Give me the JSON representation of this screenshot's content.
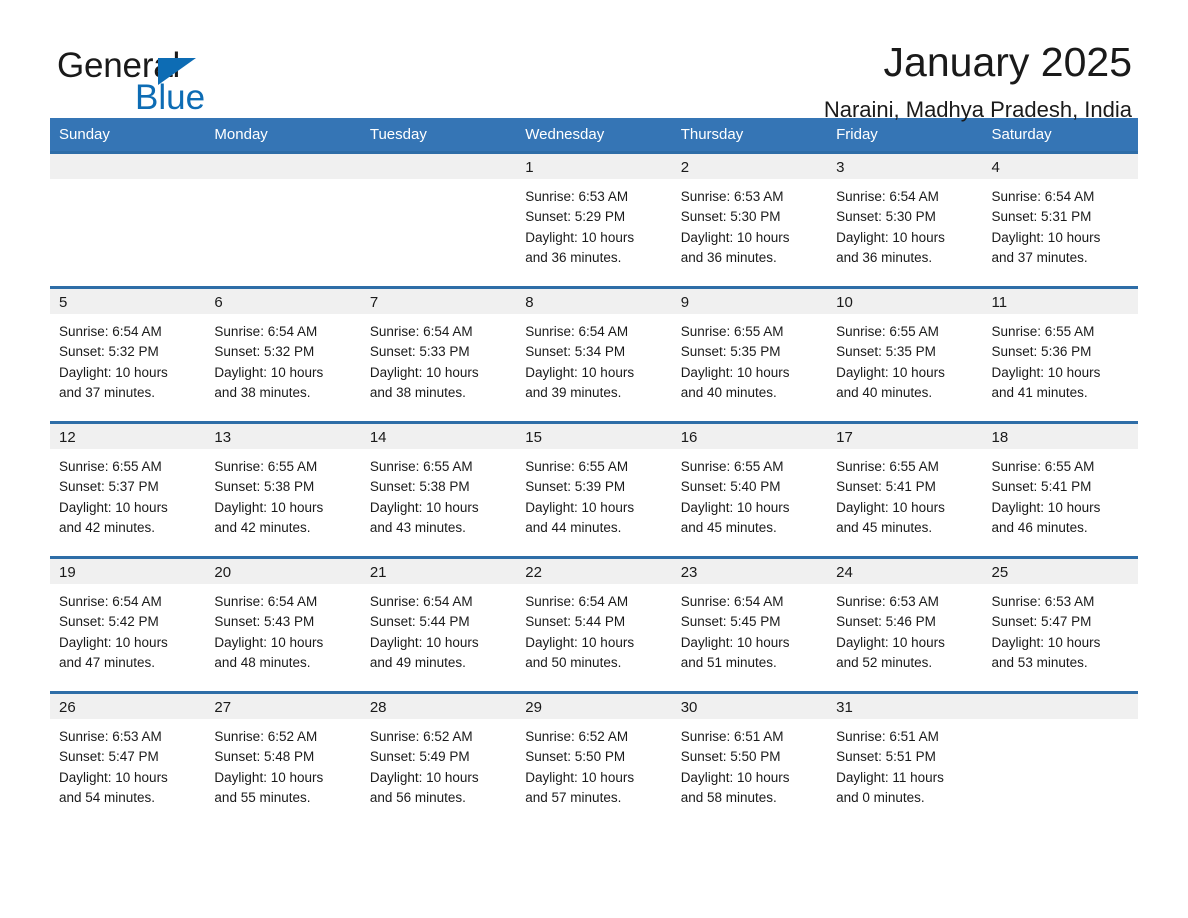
{
  "brand": {
    "word1": "General",
    "word2": "Blue",
    "triangle_color": "#0d6cb4"
  },
  "header": {
    "month_title": "January 2025",
    "location": "Naraini, Madhya Pradesh, India",
    "header_bg": "#3575b5",
    "row_border": "#2e6da7",
    "daynum_bg": "#f0f0f0"
  },
  "weekdays": [
    "Sunday",
    "Monday",
    "Tuesday",
    "Wednesday",
    "Thursday",
    "Friday",
    "Saturday"
  ],
  "labels": {
    "sunrise_prefix": "Sunrise:",
    "sunset_prefix": "Sunset:",
    "daylight_prefix": "Daylight:"
  },
  "weeks": [
    [
      {
        "day": "",
        "empty": true
      },
      {
        "day": "",
        "empty": true
      },
      {
        "day": "",
        "empty": true
      },
      {
        "day": "1",
        "line1": "Sunrise: 6:53 AM",
        "line2": "Sunset: 5:29 PM",
        "line3": "Daylight: 10 hours",
        "line4": "and 36 minutes."
      },
      {
        "day": "2",
        "line1": "Sunrise: 6:53 AM",
        "line2": "Sunset: 5:30 PM",
        "line3": "Daylight: 10 hours",
        "line4": "and 36 minutes."
      },
      {
        "day": "3",
        "line1": "Sunrise: 6:54 AM",
        "line2": "Sunset: 5:30 PM",
        "line3": "Daylight: 10 hours",
        "line4": "and 36 minutes."
      },
      {
        "day": "4",
        "line1": "Sunrise: 6:54 AM",
        "line2": "Sunset: 5:31 PM",
        "line3": "Daylight: 10 hours",
        "line4": "and 37 minutes."
      }
    ],
    [
      {
        "day": "5",
        "line1": "Sunrise: 6:54 AM",
        "line2": "Sunset: 5:32 PM",
        "line3": "Daylight: 10 hours",
        "line4": "and 37 minutes."
      },
      {
        "day": "6",
        "line1": "Sunrise: 6:54 AM",
        "line2": "Sunset: 5:32 PM",
        "line3": "Daylight: 10 hours",
        "line4": "and 38 minutes."
      },
      {
        "day": "7",
        "line1": "Sunrise: 6:54 AM",
        "line2": "Sunset: 5:33 PM",
        "line3": "Daylight: 10 hours",
        "line4": "and 38 minutes."
      },
      {
        "day": "8",
        "line1": "Sunrise: 6:54 AM",
        "line2": "Sunset: 5:34 PM",
        "line3": "Daylight: 10 hours",
        "line4": "and 39 minutes."
      },
      {
        "day": "9",
        "line1": "Sunrise: 6:55 AM",
        "line2": "Sunset: 5:35 PM",
        "line3": "Daylight: 10 hours",
        "line4": "and 40 minutes."
      },
      {
        "day": "10",
        "line1": "Sunrise: 6:55 AM",
        "line2": "Sunset: 5:35 PM",
        "line3": "Daylight: 10 hours",
        "line4": "and 40 minutes."
      },
      {
        "day": "11",
        "line1": "Sunrise: 6:55 AM",
        "line2": "Sunset: 5:36 PM",
        "line3": "Daylight: 10 hours",
        "line4": "and 41 minutes."
      }
    ],
    [
      {
        "day": "12",
        "line1": "Sunrise: 6:55 AM",
        "line2": "Sunset: 5:37 PM",
        "line3": "Daylight: 10 hours",
        "line4": "and 42 minutes."
      },
      {
        "day": "13",
        "line1": "Sunrise: 6:55 AM",
        "line2": "Sunset: 5:38 PM",
        "line3": "Daylight: 10 hours",
        "line4": "and 42 minutes."
      },
      {
        "day": "14",
        "line1": "Sunrise: 6:55 AM",
        "line2": "Sunset: 5:38 PM",
        "line3": "Daylight: 10 hours",
        "line4": "and 43 minutes."
      },
      {
        "day": "15",
        "line1": "Sunrise: 6:55 AM",
        "line2": "Sunset: 5:39 PM",
        "line3": "Daylight: 10 hours",
        "line4": "and 44 minutes."
      },
      {
        "day": "16",
        "line1": "Sunrise: 6:55 AM",
        "line2": "Sunset: 5:40 PM",
        "line3": "Daylight: 10 hours",
        "line4": "and 45 minutes."
      },
      {
        "day": "17",
        "line1": "Sunrise: 6:55 AM",
        "line2": "Sunset: 5:41 PM",
        "line3": "Daylight: 10 hours",
        "line4": "and 45 minutes."
      },
      {
        "day": "18",
        "line1": "Sunrise: 6:55 AM",
        "line2": "Sunset: 5:41 PM",
        "line3": "Daylight: 10 hours",
        "line4": "and 46 minutes."
      }
    ],
    [
      {
        "day": "19",
        "line1": "Sunrise: 6:54 AM",
        "line2": "Sunset: 5:42 PM",
        "line3": "Daylight: 10 hours",
        "line4": "and 47 minutes."
      },
      {
        "day": "20",
        "line1": "Sunrise: 6:54 AM",
        "line2": "Sunset: 5:43 PM",
        "line3": "Daylight: 10 hours",
        "line4": "and 48 minutes."
      },
      {
        "day": "21",
        "line1": "Sunrise: 6:54 AM",
        "line2": "Sunset: 5:44 PM",
        "line3": "Daylight: 10 hours",
        "line4": "and 49 minutes."
      },
      {
        "day": "22",
        "line1": "Sunrise: 6:54 AM",
        "line2": "Sunset: 5:44 PM",
        "line3": "Daylight: 10 hours",
        "line4": "and 50 minutes."
      },
      {
        "day": "23",
        "line1": "Sunrise: 6:54 AM",
        "line2": "Sunset: 5:45 PM",
        "line3": "Daylight: 10 hours",
        "line4": "and 51 minutes."
      },
      {
        "day": "24",
        "line1": "Sunrise: 6:53 AM",
        "line2": "Sunset: 5:46 PM",
        "line3": "Daylight: 10 hours",
        "line4": "and 52 minutes."
      },
      {
        "day": "25",
        "line1": "Sunrise: 6:53 AM",
        "line2": "Sunset: 5:47 PM",
        "line3": "Daylight: 10 hours",
        "line4": "and 53 minutes."
      }
    ],
    [
      {
        "day": "26",
        "line1": "Sunrise: 6:53 AM",
        "line2": "Sunset: 5:47 PM",
        "line3": "Daylight: 10 hours",
        "line4": "and 54 minutes."
      },
      {
        "day": "27",
        "line1": "Sunrise: 6:52 AM",
        "line2": "Sunset: 5:48 PM",
        "line3": "Daylight: 10 hours",
        "line4": "and 55 minutes."
      },
      {
        "day": "28",
        "line1": "Sunrise: 6:52 AM",
        "line2": "Sunset: 5:49 PM",
        "line3": "Daylight: 10 hours",
        "line4": "and 56 minutes."
      },
      {
        "day": "29",
        "line1": "Sunrise: 6:52 AM",
        "line2": "Sunset: 5:50 PM",
        "line3": "Daylight: 10 hours",
        "line4": "and 57 minutes."
      },
      {
        "day": "30",
        "line1": "Sunrise: 6:51 AM",
        "line2": "Sunset: 5:50 PM",
        "line3": "Daylight: 10 hours",
        "line4": "and 58 minutes."
      },
      {
        "day": "31",
        "line1": "Sunrise: 6:51 AM",
        "line2": "Sunset: 5:51 PM",
        "line3": "Daylight: 11 hours",
        "line4": "and 0 minutes."
      },
      {
        "day": "",
        "empty": true
      }
    ]
  ]
}
